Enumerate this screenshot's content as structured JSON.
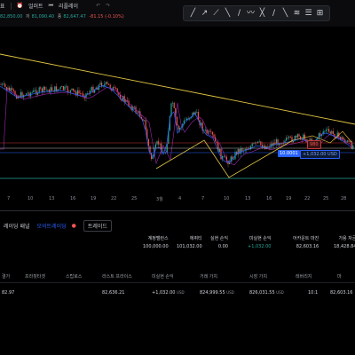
{
  "menu": {
    "left_label": "표",
    "alert_label": "얼러트",
    "replay_label": "리플레이"
  },
  "ohlc": {
    "o": "82,850.00",
    "h_label": "저",
    "h": "81,090.40",
    "c_label": "종",
    "c": "82,647.47",
    "chg": "-81.15 (-0.10%)"
  },
  "draw_tools": [
    "╱",
    "↗",
    "⟋",
    "╲",
    "/",
    "〰",
    "╳",
    "∕",
    "╲",
    "≋",
    "☰",
    "⊞"
  ],
  "price_tags": {
    "red_small": "980",
    "blue_label": "10.0001",
    "position_pl": "+1,032.00 USD"
  },
  "xaxis": [
    "7",
    "10",
    "13",
    "16",
    "19",
    "22",
    "25",
    "3월",
    "4",
    "7",
    "10",
    "13",
    "16",
    "19",
    "22",
    "25",
    "28"
  ],
  "colors": {
    "trendline": "#e2c541",
    "support_green": "#26a69a",
    "red_line": "#c53a3a",
    "blue_line": "#2962ff",
    "accent": "#2962ff"
  },
  "panel_tabs": {
    "trading_panel": "레이딩 패널",
    "paper_trading": "모의트레이딩",
    "trade_button": "트레이드"
  },
  "account": [
    {
      "label": "계정밸런스",
      "value": "100,000.00",
      "pos": false
    },
    {
      "label": "에퀴티",
      "value": "101,032.00",
      "pos": false
    },
    {
      "label": "실현 손익",
      "value": "0.00",
      "pos": false
    },
    {
      "label": "미실현 손익",
      "value": "+1,032.00",
      "pos": true
    },
    {
      "label": "어카운트 마진",
      "value": "82,603.16",
      "pos": false
    },
    {
      "label": "가용 자금",
      "value": "18,428.84",
      "pos": false
    }
  ],
  "table": {
    "headers": [
      "결가",
      "프라핏타겟",
      "스탑로스",
      "라스트 프라이스",
      "미실현 손익",
      "거래 가치",
      "시장 가치",
      "레버리지",
      "마"
    ],
    "row": {
      "entry": "82.97",
      "last_price": "82,636.21",
      "pnl": "+1,032.00",
      "pnl_unit": "USD",
      "trade_value": "824,999.55",
      "trade_unit": "USD",
      "market_value": "826,031.55",
      "market_unit": "USD",
      "leverage": "10:1",
      "margin": "82,603.16"
    }
  }
}
